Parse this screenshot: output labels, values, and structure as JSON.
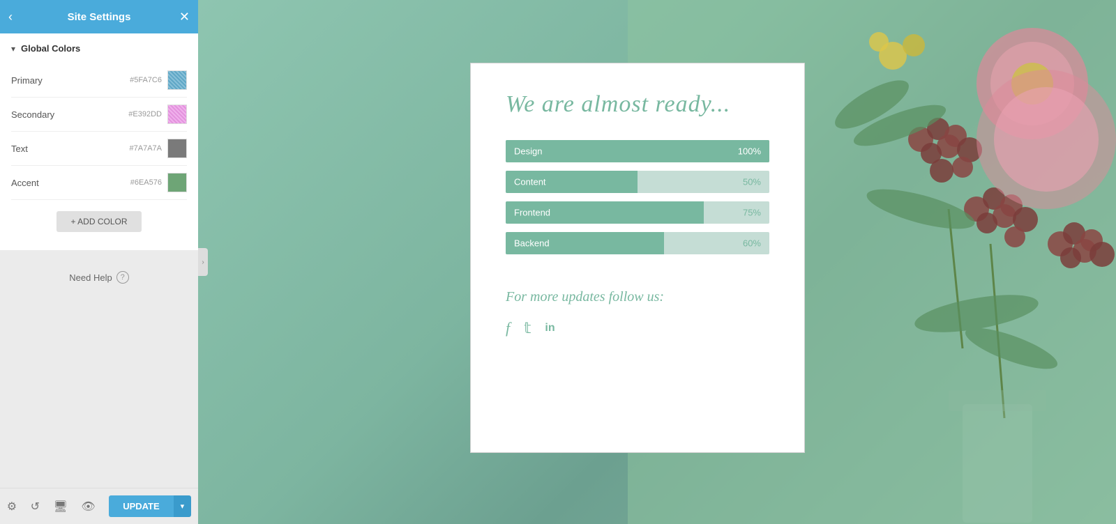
{
  "panel": {
    "title": "Site Settings",
    "back_icon": "‹",
    "close_icon": "✕",
    "section": {
      "label": "Global Colors",
      "chevron": "▾"
    },
    "colors": [
      {
        "label": "Primary",
        "hex": "#5FA7C6",
        "swatch_class": "swatch-primary"
      },
      {
        "label": "Secondary",
        "hex": "#E392DD",
        "swatch_class": "swatch-secondary"
      },
      {
        "label": "Text",
        "hex": "#7A7A7A",
        "swatch_class": "swatch-text"
      },
      {
        "label": "Accent",
        "hex": "#6EA576",
        "swatch_class": "swatch-accent"
      }
    ],
    "add_color_label": "+ ADD COLOR",
    "need_help_label": "Need Help",
    "help_icon": "?",
    "footer": {
      "update_label": "UPDATE",
      "dropdown_arrow": "▾"
    }
  },
  "card": {
    "title": "We are almost ready...",
    "progress_bars": [
      {
        "label": "Design",
        "pct": 100,
        "pct_label": "100%"
      },
      {
        "label": "Content",
        "pct": 50,
        "pct_label": "50%"
      },
      {
        "label": "Frontend",
        "pct": 75,
        "pct_label": "75%"
      },
      {
        "label": "Backend",
        "pct": 60,
        "pct_label": "60%"
      }
    ],
    "subtitle": "For more updates follow us:",
    "social": [
      {
        "icon": "f",
        "label": "facebook"
      },
      {
        "icon": "𝕥",
        "label": "twitter"
      },
      {
        "icon": "in",
        "label": "linkedin"
      }
    ]
  },
  "colors": {
    "primary_blue": "#4aabdb",
    "teal": "#78b8a0",
    "light_teal": "#c5ddd5"
  }
}
